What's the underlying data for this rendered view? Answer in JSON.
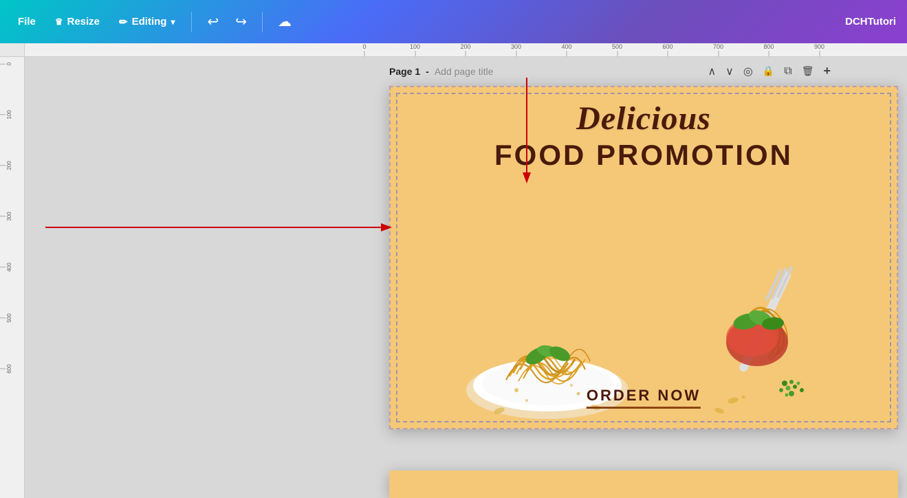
{
  "toolbar": {
    "file_label": "File",
    "resize_label": "Resize",
    "editing_label": "Editing",
    "undo_icon": "↩",
    "redo_icon": "↪",
    "cloud_icon": "☁",
    "brand_name": "DCHTutori",
    "crown_icon": "♛"
  },
  "page": {
    "label": "Page 1",
    "separator": " - ",
    "add_title_label": "Add page title"
  },
  "page_controls": {
    "up_icon": "∧",
    "down_icon": "∨",
    "eye_icon": "◎",
    "lock_icon": "🔒",
    "copy_icon": "⧉",
    "delete_icon": "🗑",
    "add_icon": "+"
  },
  "design": {
    "title_script": "Delicious",
    "title_block": "FOOD PROMOTION",
    "order_label": "ORDER NOW",
    "bg_color": "#f5c878"
  },
  "rulers": {
    "top_ticks": [
      0,
      100,
      200,
      300,
      400,
      500,
      600,
      700,
      800,
      900
    ],
    "left_ticks": [
      0,
      100,
      200,
      300,
      400,
      500,
      600
    ]
  }
}
